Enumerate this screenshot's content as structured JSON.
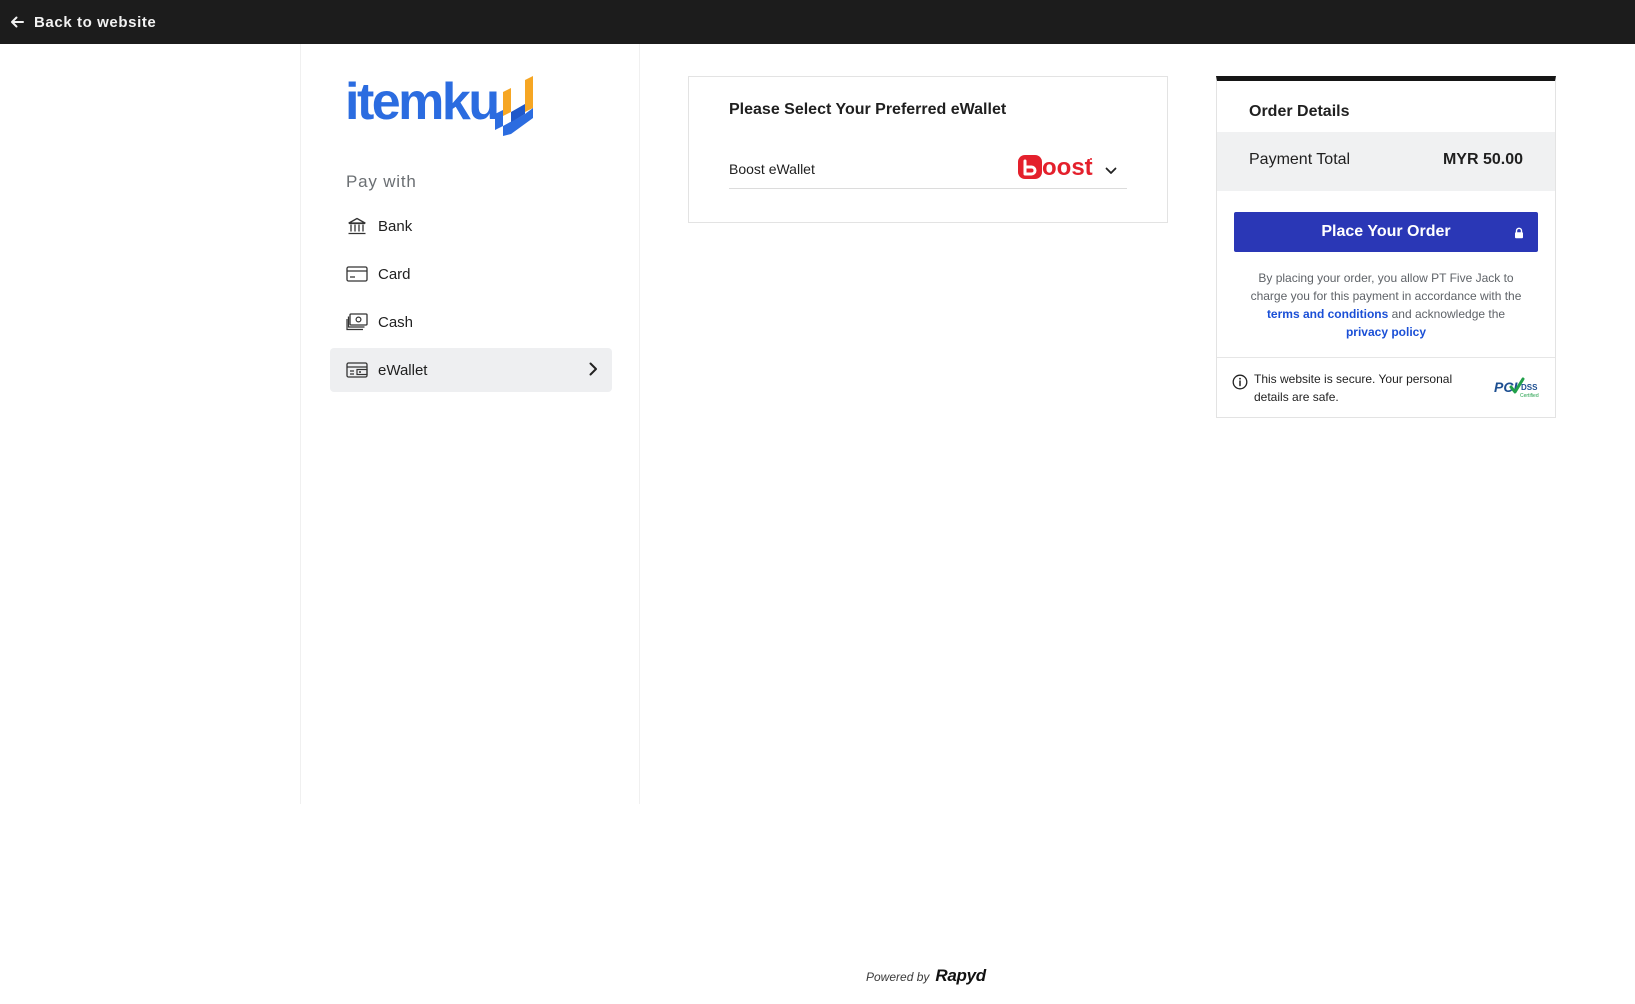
{
  "topbar": {
    "back_label": "Back to website",
    "back_icon": "arrow-left-icon"
  },
  "brand": {
    "logo_text": "itemku",
    "logo_colors": {
      "text": "#2b6ce0",
      "mark_orange": "#f6a623",
      "mark_blue": "#2b6ce0"
    }
  },
  "sidebar": {
    "heading": "Pay with",
    "items": [
      {
        "label": "Bank",
        "icon": "bank-icon",
        "active": false
      },
      {
        "label": "Card",
        "icon": "credit-card-icon",
        "active": false
      },
      {
        "label": "Cash",
        "icon": "cash-icon",
        "active": false
      },
      {
        "label": "eWallet",
        "icon": "wallet-icon",
        "active": true
      }
    ]
  },
  "ewallet": {
    "title": "Please Select Your Preferred eWallet",
    "selected_label": "Boost eWallet",
    "selected_logo": "boost-logo",
    "boost_logo_text": "oost",
    "boost_color": "#e4202c"
  },
  "order": {
    "title": "Order Details",
    "total_label": "Payment Total",
    "total_value": "MYR 50.00",
    "place_order_label": "Place Your Order",
    "button_color": "#2a37b6",
    "consent_part1": "By placing your order, you allow PT Five Jack to charge you for this payment in accordance with the ",
    "terms_link": "terms and conditions",
    "consent_part2": " and acknowledge the ",
    "privacy_link": "privacy policy",
    "secure_text": "This website is secure. Your personal details are safe.",
    "pci_label": "PCI",
    "pci_dss": "DSS",
    "pci_certified": "Certified"
  },
  "footer": {
    "powered_by": "Powered by",
    "brand": "Rapyd"
  }
}
